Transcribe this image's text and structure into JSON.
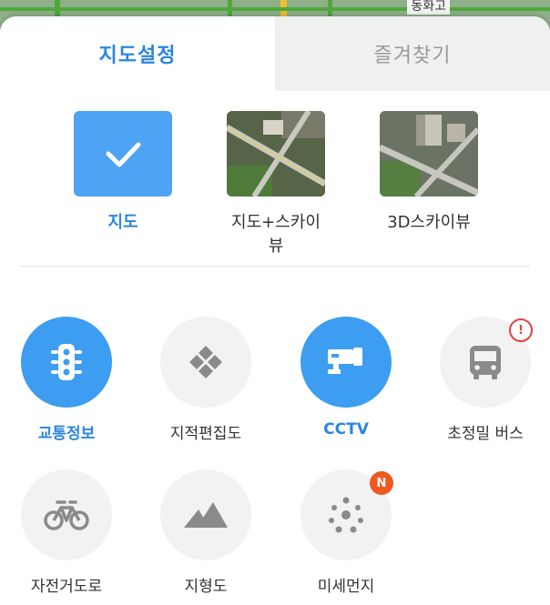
{
  "map_preview": {
    "place_label": "동화고"
  },
  "tabs": [
    {
      "label": "지도설정",
      "active": true
    },
    {
      "label": "즐겨찾기",
      "active": false
    }
  ],
  "map_types": [
    {
      "label": "지도",
      "selected": true,
      "icon": "checkmark-icon"
    },
    {
      "label": "지도+스카이뷰",
      "selected": false,
      "icon": "satellite-thumbnail"
    },
    {
      "label": "3D스카이뷰",
      "selected": false,
      "icon": "3d-satellite-thumbnail"
    }
  ],
  "layers": [
    {
      "label": "교통정보",
      "on": true,
      "icon": "traffic-light-icon"
    },
    {
      "label": "지적편집도",
      "on": false,
      "icon": "cadastral-map-icon"
    },
    {
      "label": "CCTV",
      "on": true,
      "icon": "cctv-camera-icon"
    },
    {
      "label": "초정밀 버스",
      "on": false,
      "icon": "bus-icon",
      "badge": "!"
    },
    {
      "label": "자전거도로",
      "on": false,
      "icon": "bicycle-icon"
    },
    {
      "label": "지형도",
      "on": false,
      "icon": "mountain-icon"
    },
    {
      "label": "미세먼지",
      "on": false,
      "icon": "dust-dots-icon",
      "badge": "N"
    }
  ],
  "colors": {
    "accent": "#2a86e0",
    "on_circle": "#3d9df0",
    "inactive_icon": "#8a8a8a",
    "warn": "#e54141",
    "new_badge": "#ef5a22"
  }
}
